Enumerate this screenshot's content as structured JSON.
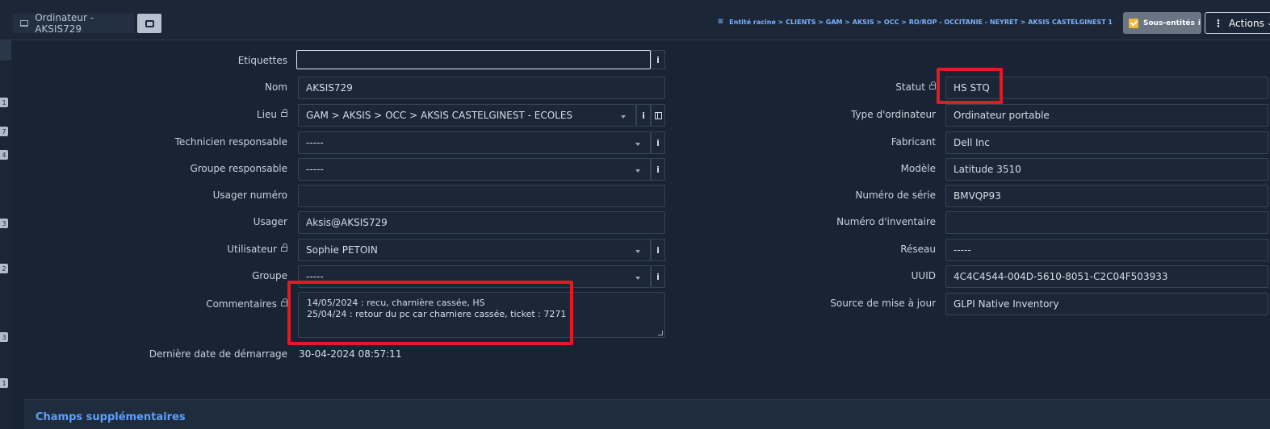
{
  "header": {
    "title": "Ordinateur - AKSIS729",
    "breadcrumb": "Entité racine > CLIENTS > GAM > AKSIS > OCC > RO/ROP - OCCITANIE - NEYRET > AKSIS CASTELGINEST 1",
    "sub_entities_label": "Sous-entités",
    "actions_label": "Actions"
  },
  "rail_badges": [
    "1",
    "7",
    "4",
    "3",
    "2",
    "3",
    "1"
  ],
  "form": {
    "left": {
      "etiquettes": {
        "label": "Etiquettes",
        "value": ""
      },
      "nom": {
        "label": "Nom",
        "value": "AKSIS729"
      },
      "lieu": {
        "label": "Lieu",
        "value": "GAM > AKSIS > OCC > AKSIS CASTELGINEST - ECOLES"
      },
      "technicien": {
        "label": "Technicien responsable",
        "value": "-----"
      },
      "groupe_responsable": {
        "label": "Groupe responsable",
        "value": "-----"
      },
      "usager_numero": {
        "label": "Usager numéro",
        "value": ""
      },
      "usager": {
        "label": "Usager",
        "value": "Aksis@AKSIS729"
      },
      "utilisateur": {
        "label": "Utilisateur",
        "value": "Sophie PETOIN"
      },
      "groupe": {
        "label": "Groupe",
        "value": "-----"
      },
      "commentaires": {
        "label": "Commentaires",
        "line1": "14/05/2024 : recu, charnière cassée, HS",
        "line2": "25/04/24 : retour du pc car charniere cassée, ticket : 7271"
      },
      "derniere_date": {
        "label": "Dernière date de démarrage",
        "value": "30-04-2024 08:57:11"
      }
    },
    "right": {
      "statut": {
        "label": "Statut",
        "value": "HS STQ"
      },
      "type": {
        "label": "Type d'ordinateur",
        "value": "Ordinateur portable"
      },
      "fabricant": {
        "label": "Fabricant",
        "value": "Dell Inc"
      },
      "modele": {
        "label": "Modèle",
        "value": "Latitude 3510"
      },
      "serie": {
        "label": "Numéro de série",
        "value": "BMVQP93"
      },
      "inventaire": {
        "label": "Numéro d'inventaire",
        "value": ""
      },
      "reseau": {
        "label": "Réseau",
        "value": "-----"
      },
      "uuid": {
        "label": "UUID",
        "value": "4C4C4544-004D-5610-8051-C2C04F503933"
      },
      "source": {
        "label": "Source de mise à jour",
        "value": "GLPI Native Inventory"
      }
    }
  },
  "extra_section": {
    "title": "Champs supplémentaires"
  },
  "info_glyph": "i"
}
